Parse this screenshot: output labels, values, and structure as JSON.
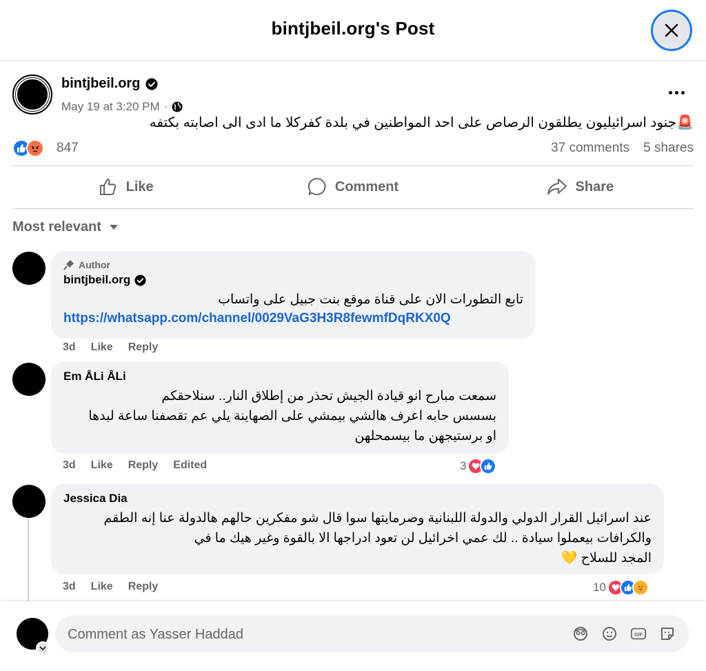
{
  "header": {
    "title": "bintjbeil.org's Post"
  },
  "post": {
    "author": "bintjbeil.org",
    "timestamp": "May 19 at 3:20 PM",
    "separator": "·",
    "emoji": "🚨",
    "text": "جنود اسرائيليون يطلقون الرصاص على احد المواطنين في بلدة كفركلا ما ادى الى اصابته بكتفه",
    "reaction_count": "847",
    "comments_count": "37 comments",
    "shares_count": "5 shares"
  },
  "actions": {
    "like": "Like",
    "comment": "Comment",
    "share": "Share"
  },
  "sort": {
    "label": "Most relevant"
  },
  "comments": [
    {
      "author_tag": "Author",
      "name": "bintjbeil.org",
      "lines": [
        "تابع التطورات الان على قناة موقع بنت جبيل على واتساب"
      ],
      "link": "https://whatsapp.com/channel/0029VaG3H3R8fewmfDqRKX0Q",
      "time": "3d",
      "like": "Like",
      "reply": "Reply"
    },
    {
      "name": "Em ÅLi ÅLi",
      "lines": [
        "سمعت مبارح انو قيادة الجيش تحذر من إطلاق النار.. سنلاحقكم",
        "بسسس حابه اعرف هالشي بيمشي على الصهاينة يلي عم تقصفنا ساعة لبدها",
        "او برستيجهن ما بيسمحلهن"
      ],
      "time": "3d",
      "like": "Like",
      "reply": "Reply",
      "edited": "Edited",
      "reaction_count": "3"
    },
    {
      "name": "Jessica Dia",
      "lines": [
        "عند اسرائيل القرار الدولي والدولة اللبنانية وصرمايتها سوا قال شو مفكرين حالهم هالدولة عنا إنه الطقم",
        "والكرافات بيعملوا سيادة .. لك عمي اخرائيل لن تعود ادراجها الا بالقوة وغير هيك ما في",
        "المجد للسلاح 💛"
      ],
      "time": "3d",
      "like": "Like",
      "reply": "Reply",
      "reaction_count": "10"
    }
  ],
  "composer": {
    "placeholder": "Comment as Yasser Haddad"
  },
  "colors": {
    "accent": "#1877f2",
    "like_blue": "#1877f2",
    "love_red": "#f33e58",
    "angry_orange": "#f7714c"
  }
}
